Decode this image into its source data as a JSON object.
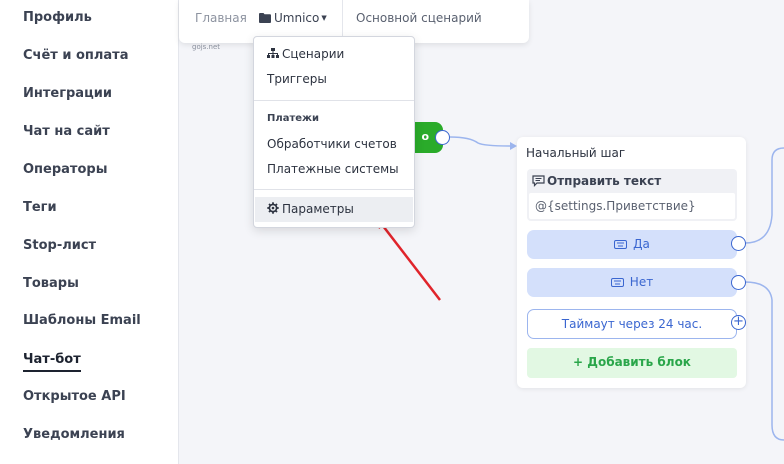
{
  "sidebar": {
    "items": [
      {
        "label": "Профиль"
      },
      {
        "label": "Счёт и оплата"
      },
      {
        "label": "Интеграции"
      },
      {
        "label": "Чат на сайт"
      },
      {
        "label": "Операторы"
      },
      {
        "label": "Теги"
      },
      {
        "label": "Stop-лист"
      },
      {
        "label": "Товары"
      },
      {
        "label": "Шаблоны Email"
      },
      {
        "label": "Чат-бот",
        "active": true
      },
      {
        "label": "Открытое API"
      },
      {
        "label": "Уведомления"
      }
    ]
  },
  "breadcrumb": {
    "home": "Главная",
    "project": "Umnico",
    "project_icon": "folder-icon",
    "scenario": "Основной сценарий"
  },
  "dropdown": {
    "items_top": [
      {
        "label": "Сценарии",
        "icon": "sitemap-icon"
      },
      {
        "label": "Триггеры"
      }
    ],
    "payments_header": "Платежи",
    "items_payments": [
      {
        "label": "Обработчики счетов"
      },
      {
        "label": "Платежные системы"
      }
    ],
    "settings": {
      "label": "Параметры",
      "icon": "gear-icon"
    }
  },
  "canvas": {
    "watermark": "gojs.net",
    "start_label": "o"
  },
  "node": {
    "title": "Начальный шаг",
    "message_title": "Отправить текст",
    "message_text": "@{settings.Приветствие}",
    "option_yes": "Да",
    "option_no": "Нет",
    "timeout": "Таймаут через 24 час.",
    "add_block": "+ Добавить блок"
  },
  "colors": {
    "accent": "#3a66d0",
    "start_green": "#2aab2a",
    "add_green": "#2aa64a",
    "arrow_red": "#e0242b"
  }
}
